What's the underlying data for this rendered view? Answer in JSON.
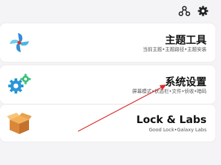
{
  "cards": [
    {
      "title": "主题工具",
      "subtitle": "当前主题•主题路径•主题安装",
      "icon": "pinwheel-icon"
    },
    {
      "title": "系统设置",
      "subtitle": "屏幕模式•状态栏•文件•侦收•暗码",
      "icon": "gears-icon"
    },
    {
      "title": "Lock & Labs",
      "subtitle": "Good Lock•Galaxy Labs",
      "icon": "box-icon"
    }
  ],
  "topbar": {
    "icons": [
      "share-icon",
      "settings-icon"
    ]
  },
  "annotation": {
    "color": "#d92b2b"
  }
}
